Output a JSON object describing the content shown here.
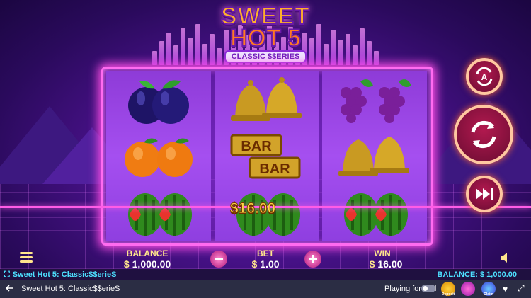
{
  "game": {
    "logo_line1": "SWEET",
    "logo_line2": "HOT 5",
    "logo_tag": "CLASSIC $$ERIES",
    "win_amount": "$16.00"
  },
  "reels": [
    [
      "plum",
      "orange",
      "watermelon"
    ],
    [
      "bell",
      "bar",
      "watermelon"
    ],
    [
      "grapes",
      "bell",
      "watermelon"
    ]
  ],
  "buttons": {
    "autoplay": "autoplay-icon",
    "spin": "spin-icon",
    "turbo": "fast-forward-icon"
  },
  "hud": {
    "balance_label": "BALANCE",
    "balance_value": "1,000.00",
    "bet_label": "BET",
    "bet_value": "1.00",
    "win_label": "WIN",
    "win_value": "16.00",
    "currency": "$"
  },
  "status": {
    "game_name": "Sweet Hot 5: Classic$$erieS",
    "balance_text": "BALANCE: $ 1,000.00"
  },
  "bottom_bar": {
    "title": "Sweet Hot 5: Classic$$erieS",
    "playing_for_real": "Playing for real",
    "badge1": "Deposit",
    "badge2": "",
    "badge3": "Claim"
  },
  "colors": {
    "frame": "#ff6bf0",
    "accent": "#ffe58c",
    "status_text": "#4de0ff"
  }
}
